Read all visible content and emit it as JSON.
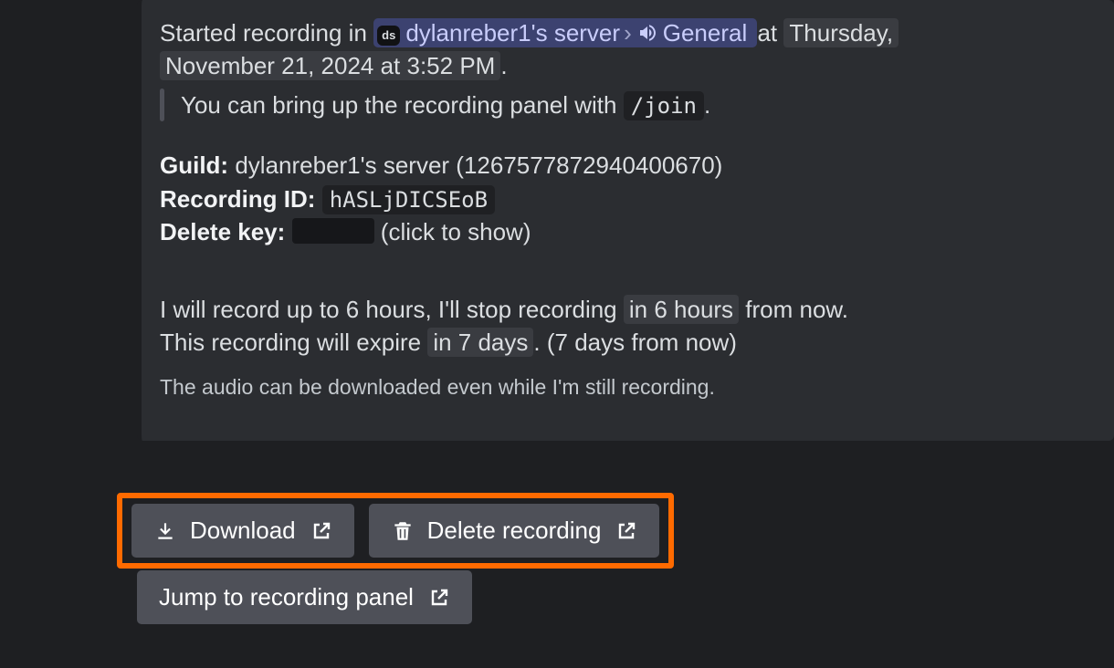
{
  "header": {
    "prefix": "Started recording in",
    "server_badge": "ds",
    "server_name": "dylanreber1's server",
    "channel_name": "General",
    "at_word": "at",
    "timestamp_line1": "Thursday,",
    "timestamp_line2": "November 21, 2024 at 3:52 PM",
    "period": "."
  },
  "hint": {
    "text_before": "You can bring up the recording panel with ",
    "command": "/join",
    "text_after": "."
  },
  "details": {
    "guild_label": "Guild:",
    "guild_value": "dylanreber1's server (1267577872940400670)",
    "recording_label": "Recording ID:",
    "recording_value": "hASLjDICSEoB",
    "delete_label": "Delete key:",
    "delete_hint": "(click to show)"
  },
  "limits": {
    "l1_a": "I will record up to 6 hours, I'll stop recording ",
    "l1_chip": "in 6 hours",
    "l1_b": " from now.",
    "l2_a": "This recording will expire ",
    "l2_chip": "in 7 days",
    "l2_b": ". (7 days from now)"
  },
  "note": "The audio can be downloaded even while I'm still recording.",
  "buttons": {
    "download": "Download",
    "delete": "Delete recording",
    "jump": "Jump to recording panel"
  }
}
